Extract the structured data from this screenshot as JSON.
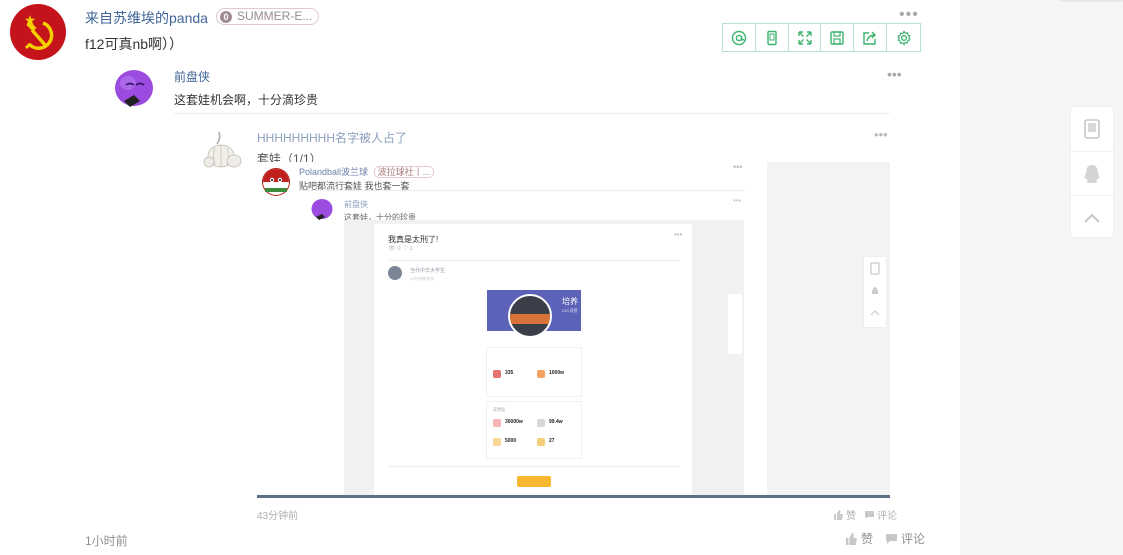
{
  "comment": {
    "user_name": "来自苏维埃的panda",
    "badge_level": "0",
    "badge_text": "SUMMER-E...",
    "more": "•••",
    "text": "f12可真nb啊））",
    "time": "1小时前",
    "like_label": "赞",
    "reply_label": "评论"
  },
  "toolbar": {
    "icons": [
      "at-icon",
      "mobile-icon",
      "fullscreen-icon",
      "save-icon",
      "share-icon",
      "settings-icon"
    ]
  },
  "reply1": {
    "user_name": "前盘侠",
    "text": "这套娃机会啊，十分滴珍贵",
    "more": "•••"
  },
  "reply2": {
    "user_name": "HHHHHHHHH名字被人占了",
    "text": "套娃（1/1）",
    "more": "•••",
    "time": "43分钟前",
    "like_label": "赞",
    "reply_label": "评论"
  },
  "embedded": {
    "user_name": "Polandball波兰球",
    "badge": "波拉球社丨...",
    "text": "贴吧都流行套娃 我也套一套",
    "more": "•••",
    "reply_name": "前盘侠",
    "reply_text": "这套娃，十分的珍贵",
    "reply_more": "•••",
    "nested": {
      "title": "我真是太刑了!",
      "meta": "👁 0 ♡ 1",
      "more": "•••",
      "user_name": "当代中华大学生",
      "user_time": "10分钟前发布",
      "profile_title": "培养",
      "profile_sub": "233 获赞",
      "stat1_value": "335",
      "stat2_value": "1000w",
      "stat3_value": "30000w",
      "stat4_value": "99.4w",
      "stat5_value": "5000",
      "stat6_value": "27",
      "section_label": "获赞值"
    }
  },
  "colors": {
    "link_blue": "#406599",
    "toolbar_green": "#3cb46e",
    "soviet_red": "#c4131a",
    "gold": "#f5d000"
  }
}
